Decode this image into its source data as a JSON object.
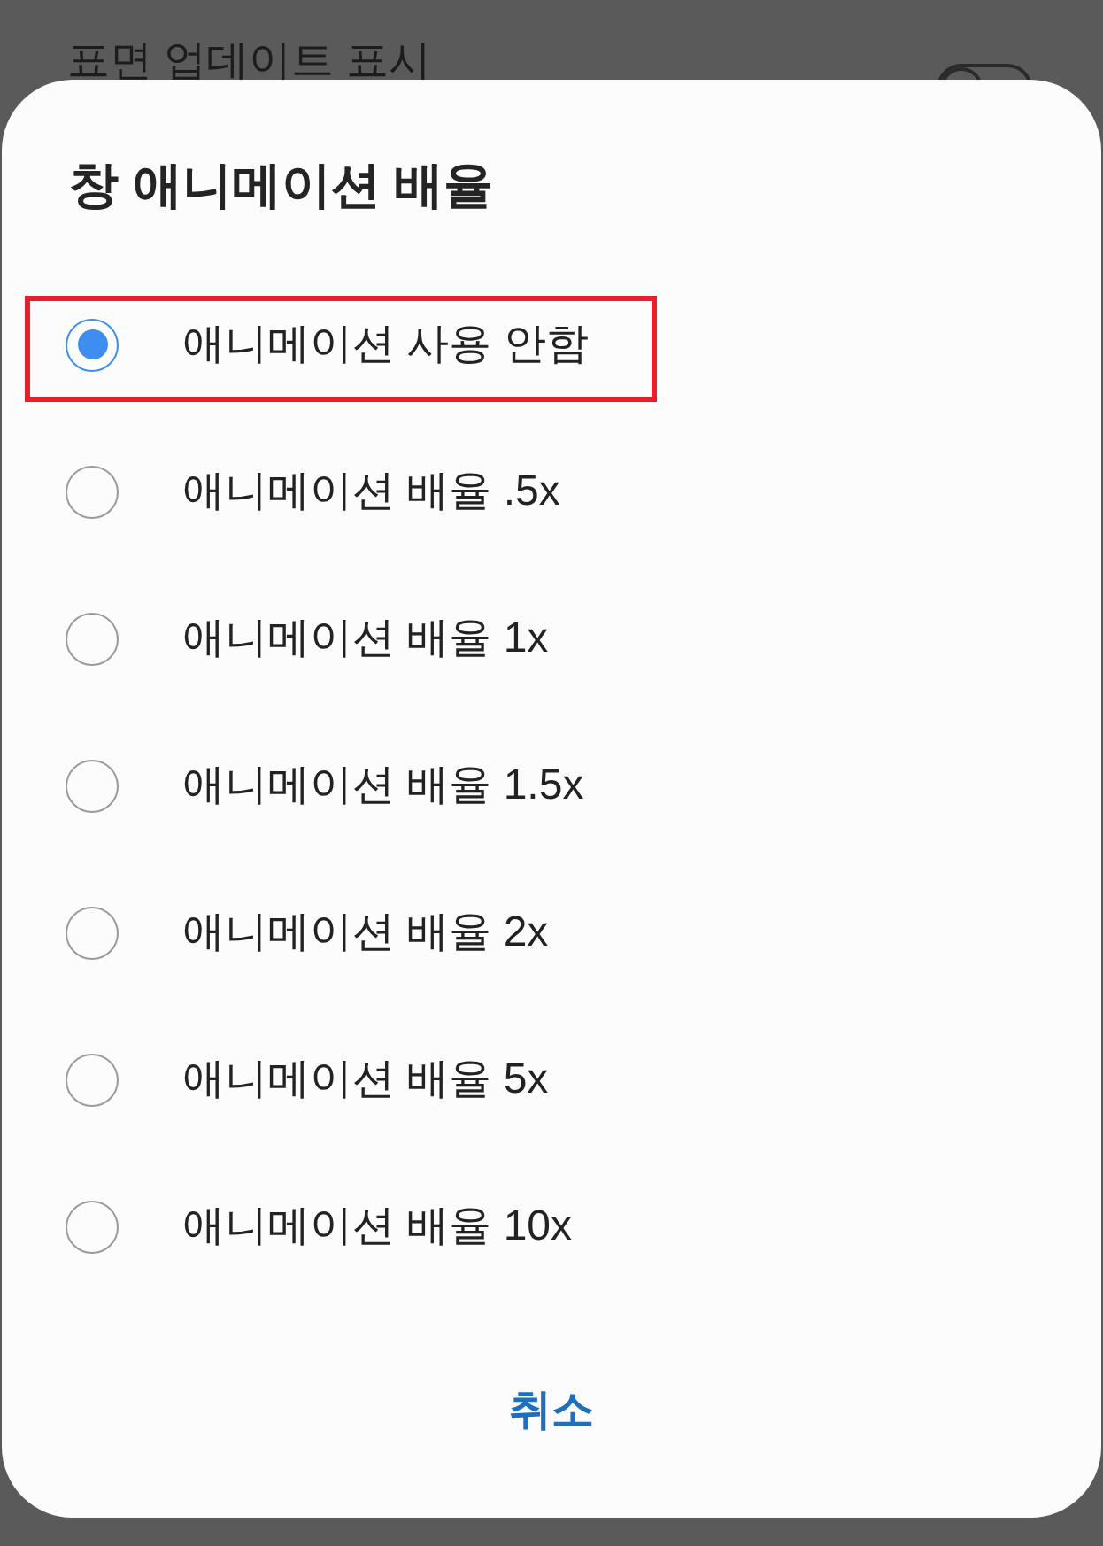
{
  "background": {
    "items": [
      {
        "label": "표면 업데이트 표시",
        "toggle": {
          "on": false
        }
      }
    ]
  },
  "dialog": {
    "title": "창 애니메이션 배율",
    "options": [
      {
        "label": "애니메이션 사용 안함",
        "selected": true,
        "highlighted": true
      },
      {
        "label": "애니메이션 배율 .5x",
        "selected": false,
        "highlighted": false
      },
      {
        "label": "애니메이션 배율 1x",
        "selected": false,
        "highlighted": false
      },
      {
        "label": "애니메이션 배율 1.5x",
        "selected": false,
        "highlighted": false
      },
      {
        "label": "애니메이션 배율 2x",
        "selected": false,
        "highlighted": false
      },
      {
        "label": "애니메이션 배율 5x",
        "selected": false,
        "highlighted": false
      },
      {
        "label": "애니메이션 배율 10x",
        "selected": false,
        "highlighted": false
      }
    ],
    "buttons": [
      {
        "label": "취소"
      }
    ]
  }
}
